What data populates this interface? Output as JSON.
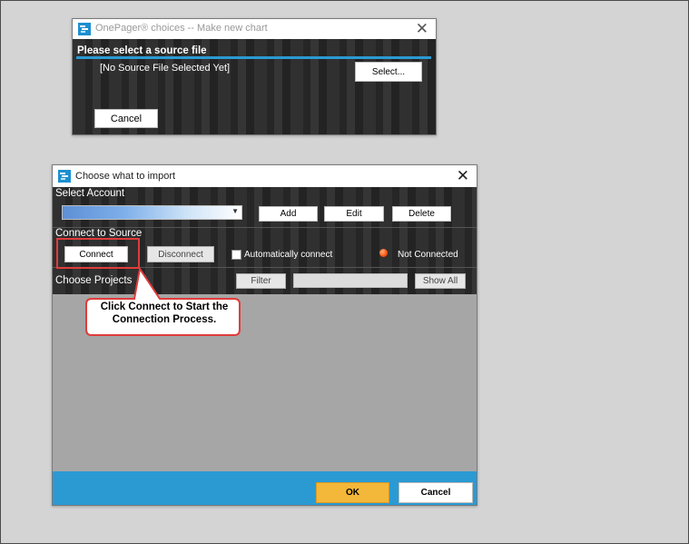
{
  "window1": {
    "title": "OnePager® choices -- Make new chart",
    "close_glyph": "✕",
    "heading": "Please select a source file",
    "source_file_status": "[No Source File Selected Yet]",
    "select_button": "Select...",
    "cancel_button": "Cancel"
  },
  "window2": {
    "title": "Choose what to import",
    "close_glyph": "✕",
    "select_account_label": "Select Account",
    "account_dropdown_value": "",
    "add_button": "Add",
    "edit_button": "Edit",
    "delete_button": "Delete",
    "connect_to_source_label": "Connect to Source",
    "connect_button": "Connect",
    "disconnect_button": "Disconnect",
    "auto_connect_label": "Automatically connect",
    "auto_connect_checked": false,
    "connection_status": "Not Connected",
    "status_color": "#ff5a16",
    "choose_projects_label": "Choose Projects",
    "filter_button": "Filter",
    "filter_value": "",
    "show_all_button": "Show All",
    "ok_button": "OK",
    "cancel_button": "Cancel"
  },
  "callout": {
    "line1": "Click Connect to Start the",
    "line2": "Connection Process."
  },
  "colors": {
    "accent_blue": "#2b9ad3",
    "ok_yellow": "#f3b73a",
    "callout_red": "#e03c3c"
  },
  "icons": {
    "app": "onepager-app-icon",
    "dropdown": "chevron-down-icon",
    "status": "status-dot-icon"
  }
}
